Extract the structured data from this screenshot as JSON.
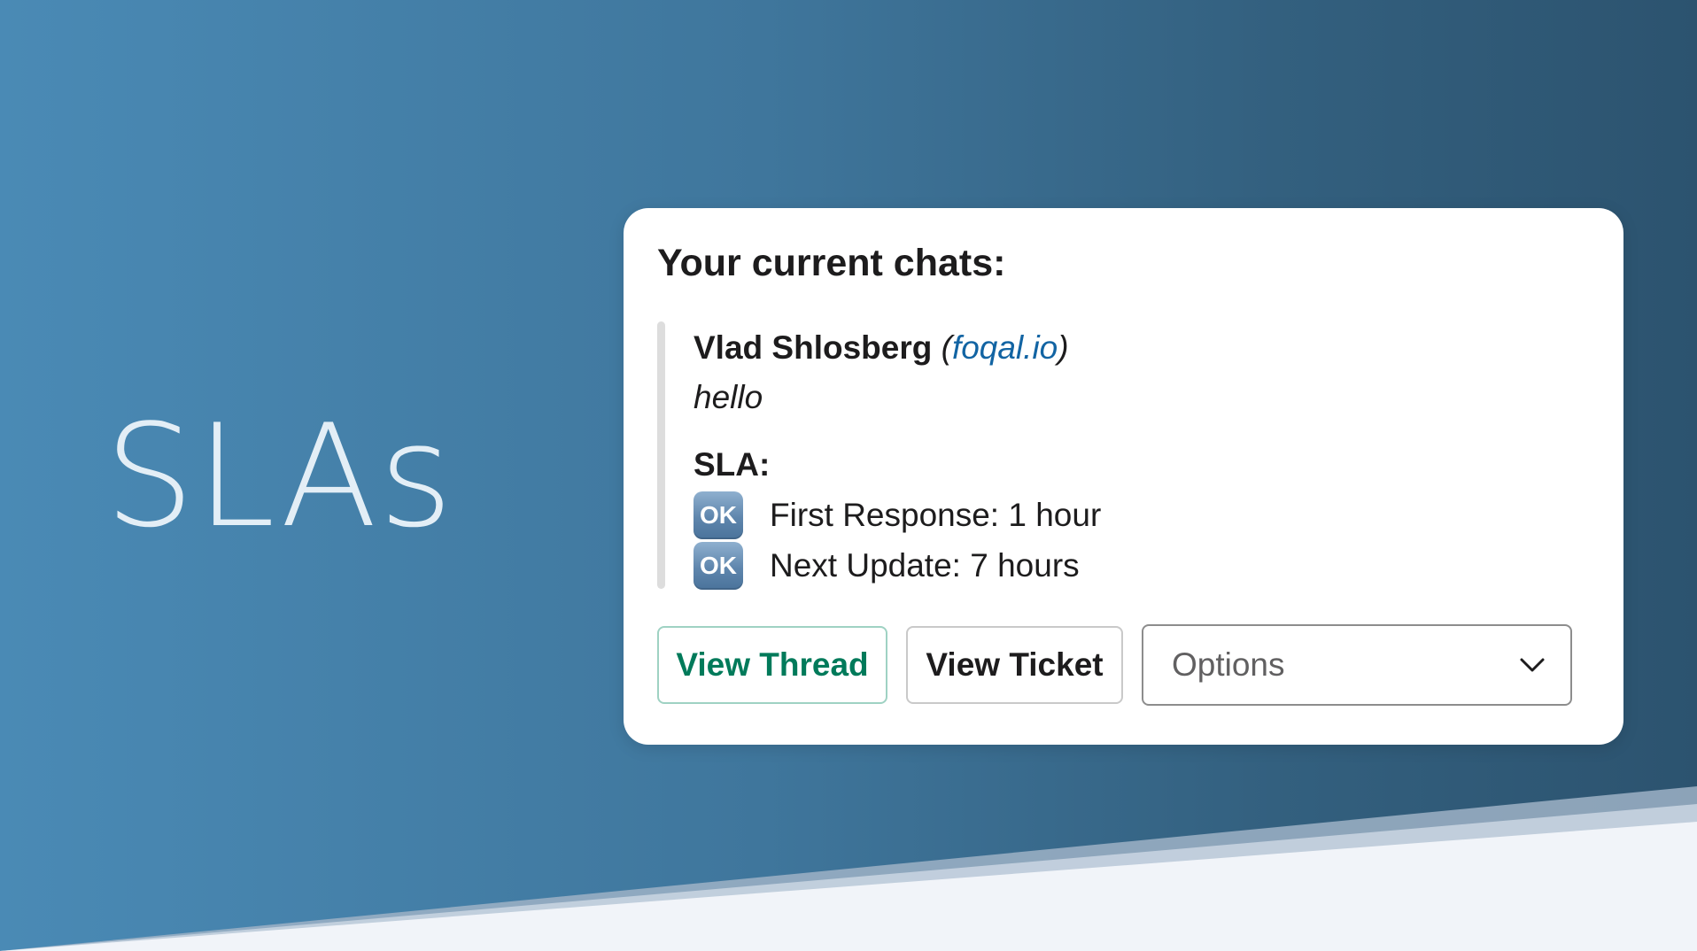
{
  "hero": {
    "title": "SLAs"
  },
  "card": {
    "heading": "Your current chats:",
    "chat": {
      "sender_name": "Vlad Shlosberg",
      "paren_open": "(",
      "domain": "foqal.io",
      "paren_close": ")",
      "message": "hello"
    },
    "sla": {
      "heading": "SLA:",
      "items": [
        {
          "badge": "OK",
          "label": "First Response: 1 hour"
        },
        {
          "badge": "OK",
          "label": "Next Update: 7 hours"
        }
      ]
    },
    "actions": {
      "view_thread": "View Thread",
      "view_ticket": "View Ticket",
      "options_placeholder": "Options"
    }
  },
  "colors": {
    "background_left": "#4a8ab5",
    "background_right": "#2c536f",
    "bottom_band": "#f1f4f9",
    "link": "#1264a3",
    "primary_button_text": "#007a5a",
    "ok_badge": "#5f86ad"
  },
  "icons": {
    "ok_badge": "ok-button-emoji",
    "dropdown": "chevron-down-icon"
  }
}
